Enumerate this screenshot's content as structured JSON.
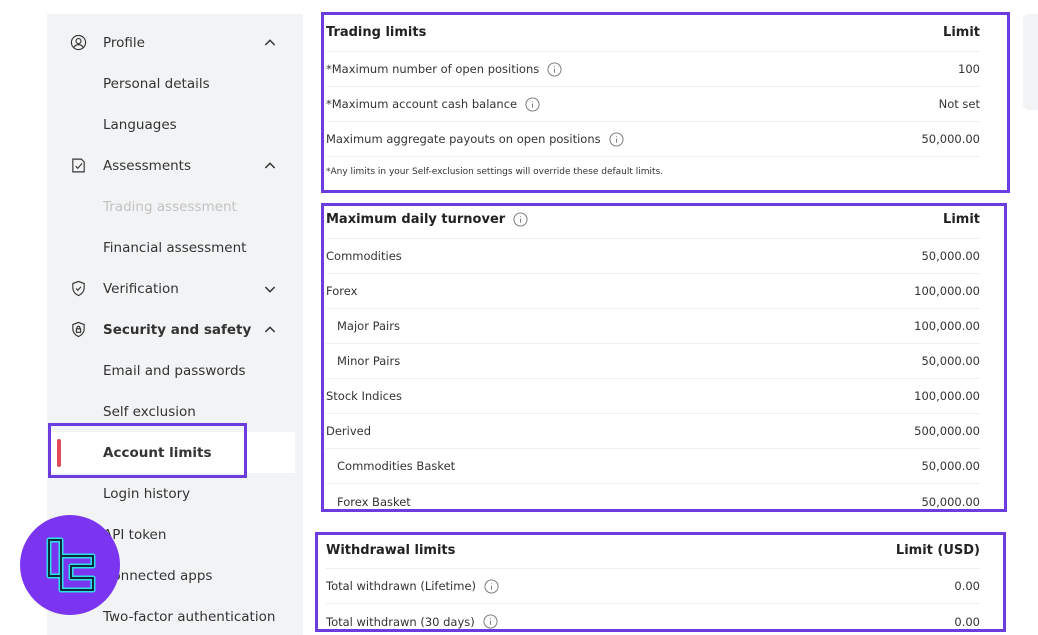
{
  "sidebar": {
    "profile": {
      "label": "Profile",
      "icon": "user-circle-icon",
      "chevron": "chevron-up-icon"
    },
    "personal_details": "Personal details",
    "languages": "Languages",
    "assessments": {
      "label": "Assessments",
      "icon": "checklist-icon",
      "chevron": "chevron-up-icon"
    },
    "trading_assessment": "Trading assessment",
    "financial_assessment": "Financial assessment",
    "verification": {
      "label": "Verification",
      "icon": "shield-check-icon",
      "chevron": "chevron-down-icon"
    },
    "security": {
      "label": "Security and safety",
      "icon": "shield-lock-icon",
      "chevron": "chevron-up-icon"
    },
    "email_passwords": "Email and passwords",
    "self_exclusion": "Self exclusion",
    "account_limits": "Account limits",
    "login_history": "Login history",
    "api_token": "API token",
    "connected_apps": "Connected apps",
    "two_factor": "Two-factor authentication"
  },
  "trading_limits": {
    "title": "Trading limits",
    "col": "Limit",
    "rows": [
      {
        "label": "*Maximum number of open positions",
        "value": "100"
      },
      {
        "label": "*Maximum account cash balance",
        "value": "Not set"
      },
      {
        "label": "Maximum aggregate payouts on open positions",
        "value": "50,000.00"
      }
    ],
    "note": "*Any limits in your Self-exclusion settings will override these default limits."
  },
  "daily_turnover": {
    "title": "Maximum daily turnover",
    "col": "Limit",
    "rows": [
      {
        "label": "Commodities",
        "value": "50,000.00"
      },
      {
        "label": "Forex",
        "value": "100,000.00"
      },
      {
        "label": "Major Pairs",
        "value": "100,000.00"
      },
      {
        "label": "Minor Pairs",
        "value": "50,000.00"
      },
      {
        "label": "Stock Indices",
        "value": "100,000.00"
      },
      {
        "label": "Derived",
        "value": "500,000.00"
      },
      {
        "label": "Commodities Basket",
        "value": "50,000.00"
      },
      {
        "label": "Forex Basket",
        "value": "50,000.00"
      }
    ]
  },
  "withdrawal_limits": {
    "title": "Withdrawal limits",
    "col": "Limit (USD)",
    "rows": [
      {
        "label": "Total withdrawn (Lifetime)",
        "value": "0.00"
      },
      {
        "label": "Total withdrawn (30 days)",
        "value": "0.00"
      }
    ]
  },
  "colors": {
    "accent_outline": "#6b3de0",
    "active_bar": "#e04b57",
    "logo_bg": "#7b35f0",
    "logo_mark": "#2de0e8"
  }
}
